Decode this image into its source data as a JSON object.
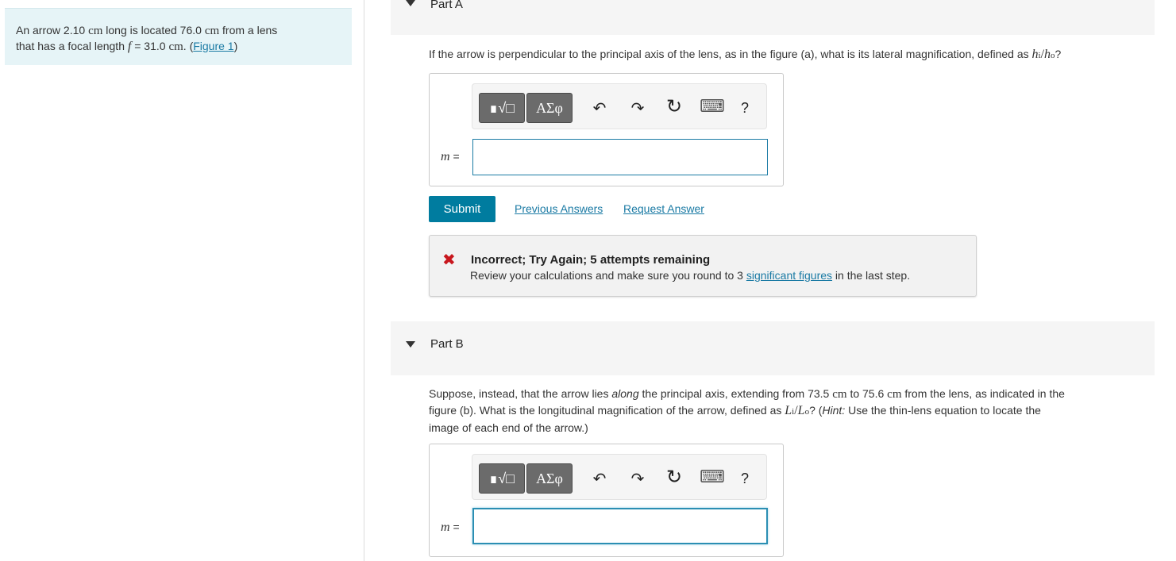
{
  "problem": {
    "intro": "An arrow 2.10",
    "unit1": "cm",
    "mid1": "long is located 76.0",
    "unit2": "cm",
    "mid2": "from a lens",
    "line2_start": "that has a focal length",
    "f_symbol": "f",
    "f_value": "= 31.0",
    "unit3": "cm",
    "dot": ".",
    "paren_open": "(",
    "figure_link": "Figure 1",
    "paren_close": ")"
  },
  "partA": {
    "label": "Part A",
    "question_text": "If the arrow is perpendicular to the principal axis of the lens, as in the figure (a), what is its lateral magnification, defined as",
    "h_symbol_1": "h",
    "sub_i": "i",
    "slash": "/",
    "h_symbol_2": "h",
    "sub_o": "o",
    "qmark": "?",
    "toolbar": {
      "template_glyph": "∎√□",
      "greek_label": "ΑΣφ",
      "undo": "↶",
      "redo": "↷",
      "reset": "↻",
      "keyboard": "⌨",
      "help": "?"
    },
    "input_label_var": "m",
    "input_label_eq": "=",
    "input_value": "",
    "submit_label": "Submit",
    "previous_answers_label": "Previous Answers",
    "request_answer_label": "Request Answer",
    "feedback": {
      "icon": "✖",
      "title": "Incorrect; Try Again; 5 attempts remaining",
      "text_before": "Review your calculations and make sure you round to 3",
      "link": "significant figures",
      "text_after": "in the last step."
    }
  },
  "partB": {
    "label": "Part B",
    "q1a": "Suppose, instead, that the arrow lies",
    "q1_along": "along",
    "q1b": "the principal axis, extending from 73.5",
    "q1_cm1": "cm",
    "q1c": "to 75.6",
    "q1_cm2": "cm",
    "q1d": "from the lens, as indicated in the",
    "q2a": "figure (b). What is the longitudinal magnification of the arrow, defined as",
    "L1": "L",
    "sub_i": "i",
    "slash": "/",
    "L2": "L",
    "sub_o": "o",
    "q2b": "? (",
    "hint": "Hint:",
    "q2c": "Use the thin-lens equation to locate the",
    "q3": "image of each end of the arrow.)",
    "toolbar": {
      "template_glyph": "∎√□",
      "greek_label": "ΑΣφ",
      "undo": "↶",
      "redo": "↷",
      "reset": "↻",
      "keyboard": "⌨",
      "help": "?"
    },
    "input_label_var": "m",
    "input_label_eq": "=",
    "input_value": ""
  }
}
